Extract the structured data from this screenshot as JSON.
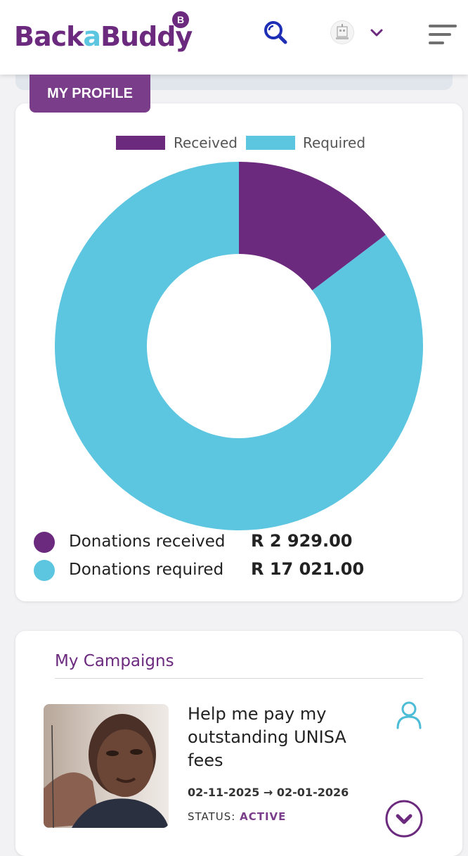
{
  "header": {
    "logo_text_1": "Back",
    "logo_text_2": "a",
    "logo_text_3": "Buddy",
    "logo_badge": "B"
  },
  "profile_tab": {
    "label": "MY PROFILE"
  },
  "chart_data": {
    "type": "pie",
    "style": "donut",
    "legend_position": "top",
    "categories": [
      "Received",
      "Required"
    ],
    "values": [
      2929.0,
      17021.0
    ],
    "colors": [
      "#6b2a7d",
      "#5cc5e0"
    ]
  },
  "donations": {
    "received_label": "Donations received",
    "received_value": "R 2 929.00",
    "required_label": "Donations required",
    "required_value": "R 17 021.00"
  },
  "campaigns": {
    "title": "My Campaigns",
    "items": [
      {
        "name": "Help me pay my outstanding UNISA fees",
        "dates": "02-11-2025 → 02-01-2026",
        "status_label": "STATUS:",
        "status_value": "ACTIVE"
      }
    ]
  },
  "colors": {
    "brand_purple": "#6b2a7d",
    "brand_blue": "#5cc5e0",
    "tab_purple": "#7a3d8a",
    "search_icon": "#1f2fb5",
    "icon_cyan": "#4dbcd6"
  },
  "icons": [
    "search-icon",
    "avatar",
    "chevron-down-icon",
    "menu-icon",
    "user-icon",
    "chevron-down-circle-icon"
  ]
}
